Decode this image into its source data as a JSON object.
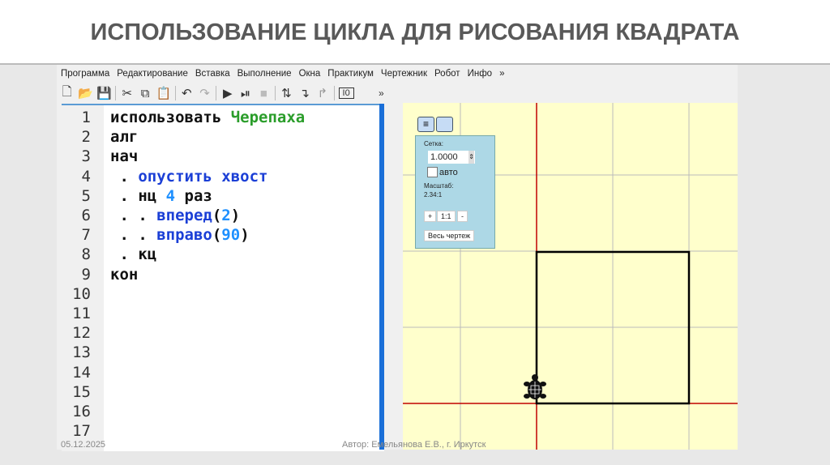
{
  "slide_title": "ИСПОЛЬЗОВАНИЕ ЦИКЛА ДЛЯ РИСОВАНИЯ КВАДРАТА",
  "menu": [
    "Программа",
    "Редактирование",
    "Вставка",
    "Выполнение",
    "Окна",
    "Практикум",
    "Чертежник",
    "Робот",
    "Инфо",
    "»"
  ],
  "toolbar_more": "»",
  "line_numbers": [
    "1",
    "2",
    "3",
    "4",
    "5",
    "6",
    "7",
    "8",
    "9",
    "10",
    "11",
    "12",
    "13",
    "14",
    "15",
    "16",
    "17"
  ],
  "code": [
    [
      {
        "t": "использовать ",
        "c": "kw"
      },
      {
        "t": "Черепаха",
        "c": "g"
      }
    ],
    [
      {
        "t": "алг",
        "c": "kw"
      }
    ],
    [
      {
        "t": "нач",
        "c": "kw"
      }
    ],
    [
      {
        "t": " . ",
        "c": "kw"
      },
      {
        "t": "опустить хвост",
        "c": "b"
      }
    ],
    [
      {
        "t": " . нц ",
        "c": "kw"
      },
      {
        "t": "4",
        "c": "n"
      },
      {
        "t": " раз",
        "c": "kw"
      }
    ],
    [
      {
        "t": " . . ",
        "c": "kw"
      },
      {
        "t": "вперед",
        "c": "b"
      },
      {
        "t": "(",
        "c": "kw"
      },
      {
        "t": "2",
        "c": "n"
      },
      {
        "t": ")",
        "c": "kw"
      }
    ],
    [
      {
        "t": " . . ",
        "c": "kw"
      },
      {
        "t": "вправо",
        "c": "b"
      },
      {
        "t": "(",
        "c": "kw"
      },
      {
        "t": "90",
        "c": "n"
      },
      {
        "t": ")",
        "c": "kw"
      }
    ],
    [
      {
        "t": " . кц",
        "c": "kw"
      }
    ],
    [
      {
        "t": "кон",
        "c": "kw"
      }
    ]
  ],
  "panel": {
    "grid_label": "Сетка:",
    "grid_value": "1.0000",
    "auto_label": "авто",
    "scale_label": "Масштаб:",
    "scale_value": "2.34:1",
    "plus": "+",
    "one_to_one": "1:1",
    "minus": "-",
    "whole_drawing": "Весь чертеж"
  },
  "footer": {
    "date": "05.12.2025",
    "author": "Автор: Емельянова Е.В., г. Иркутск"
  },
  "colors": {
    "axis": "#c00000",
    "canvas": "#ffffcc",
    "panel": "#add8e6"
  }
}
